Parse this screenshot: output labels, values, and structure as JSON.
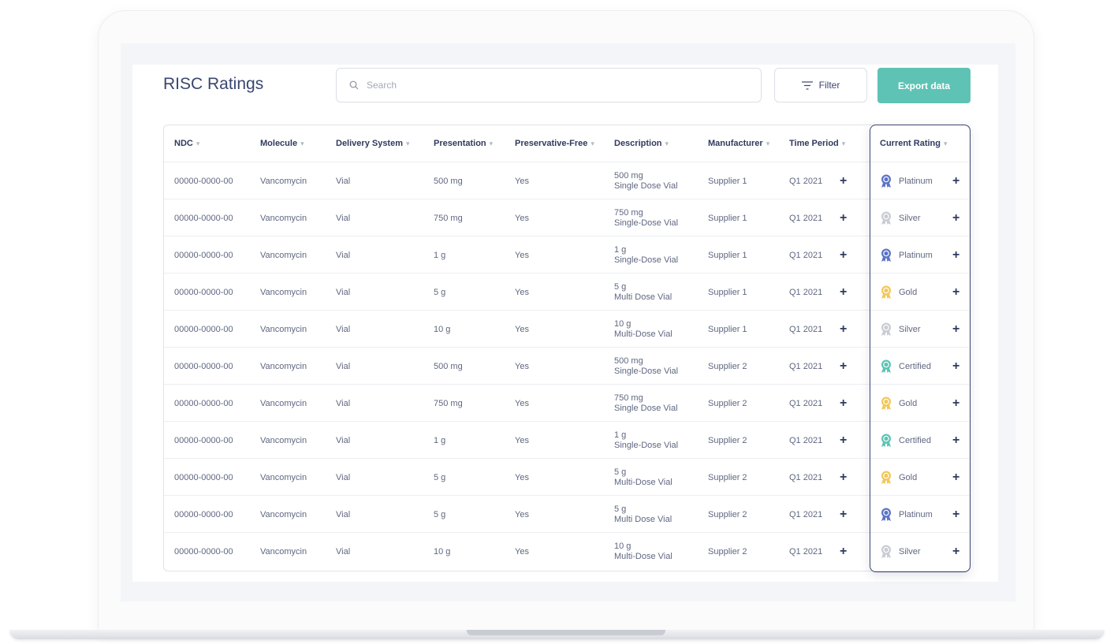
{
  "page": {
    "title": "RISC Ratings",
    "search_placeholder": "Search",
    "filter_label": "Filter",
    "export_label": "Export data"
  },
  "table": {
    "columns": [
      "NDC",
      "Molecule",
      "Delivery System",
      "Presentation",
      "Preservative-Free",
      "Description",
      "Manufacturer",
      "Time Period",
      "Current Rating"
    ],
    "rows": [
      {
        "ndc": "00000-0000-00",
        "molecule": "Vancomycin",
        "delivery": "Vial",
        "presentation": "500 mg",
        "preservative_free": "Yes",
        "desc_line1": "500 mg",
        "desc_line2": "Single Dose Vial",
        "manufacturer": "Supplier 1",
        "period": "Q1 2021",
        "rating": "Platinum"
      },
      {
        "ndc": "00000-0000-00",
        "molecule": "Vancomycin",
        "delivery": "Vial",
        "presentation": "750 mg",
        "preservative_free": "Yes",
        "desc_line1": "750 mg",
        "desc_line2": "Single-Dose Vial",
        "manufacturer": "Supplier 1",
        "period": "Q1 2021",
        "rating": "Silver"
      },
      {
        "ndc": "00000-0000-00",
        "molecule": "Vancomycin",
        "delivery": "Vial",
        "presentation": "1 g",
        "preservative_free": "Yes",
        "desc_line1": "1 g",
        "desc_line2": "Single-Dose Vial",
        "manufacturer": "Supplier 1",
        "period": "Q1 2021",
        "rating": "Platinum"
      },
      {
        "ndc": "00000-0000-00",
        "molecule": "Vancomycin",
        "delivery": "Vial",
        "presentation": "5 g",
        "preservative_free": "Yes",
        "desc_line1": "5 g",
        "desc_line2": "Multi Dose Vial",
        "manufacturer": "Supplier 1",
        "period": "Q1 2021",
        "rating": "Gold"
      },
      {
        "ndc": "00000-0000-00",
        "molecule": "Vancomycin",
        "delivery": "Vial",
        "presentation": "10 g",
        "preservative_free": "Yes",
        "desc_line1": "10 g",
        "desc_line2": "Multi-Dose Vial",
        "manufacturer": "Supplier 1",
        "period": "Q1 2021",
        "rating": "Silver"
      },
      {
        "ndc": "00000-0000-00",
        "molecule": "Vancomycin",
        "delivery": "Vial",
        "presentation": "500 mg",
        "preservative_free": "Yes",
        "desc_line1": "500 mg",
        "desc_line2": "Single-Dose Vial",
        "manufacturer": "Supplier 2",
        "period": "Q1 2021",
        "rating": "Certified"
      },
      {
        "ndc": "00000-0000-00",
        "molecule": "Vancomycin",
        "delivery": "Vial",
        "presentation": "750 mg",
        "preservative_free": "Yes",
        "desc_line1": "750 mg",
        "desc_line2": "Single Dose Vial",
        "manufacturer": "Supplier 2",
        "period": "Q1 2021",
        "rating": "Gold"
      },
      {
        "ndc": "00000-0000-00",
        "molecule": "Vancomycin",
        "delivery": "Vial",
        "presentation": "1 g",
        "preservative_free": "Yes",
        "desc_line1": "1 g",
        "desc_line2": "Single-Dose Vial",
        "manufacturer": "Supplier 2",
        "period": "Q1 2021",
        "rating": "Certified"
      },
      {
        "ndc": "00000-0000-00",
        "molecule": "Vancomycin",
        "delivery": "Vial",
        "presentation": "5 g",
        "preservative_free": "Yes",
        "desc_line1": "5 g",
        "desc_line2": "Multi-Dose Vial",
        "manufacturer": "Supplier 2",
        "period": "Q1 2021",
        "rating": "Gold"
      },
      {
        "ndc": "00000-0000-00",
        "molecule": "Vancomycin",
        "delivery": "Vial",
        "presentation": "5 g",
        "preservative_free": "Yes",
        "desc_line1": "5 g",
        "desc_line2": "Multi Dose Vial",
        "manufacturer": "Supplier 2",
        "period": "Q1 2021",
        "rating": "Platinum"
      },
      {
        "ndc": "00000-0000-00",
        "molecule": "Vancomycin",
        "delivery": "Vial",
        "presentation": "10 g",
        "preservative_free": "Yes",
        "desc_line1": "10 g",
        "desc_line2": "Multi-Dose Vial",
        "manufacturer": "Supplier 2",
        "period": "Q1 2021",
        "rating": "Silver"
      }
    ]
  },
  "rating_colors": {
    "Platinum": "#5b74c6",
    "Silver": "#c9ccd3",
    "Gold": "#f1c75a",
    "Certified": "#5ec3b5"
  },
  "icons": {
    "search": "search-icon",
    "filter": "filter-icon",
    "sort": "sort-caret-icon",
    "add": "plus-icon",
    "medal": "medal-icon"
  },
  "colors": {
    "accent": "#5ec3b5",
    "text_primary": "#3a4670"
  }
}
